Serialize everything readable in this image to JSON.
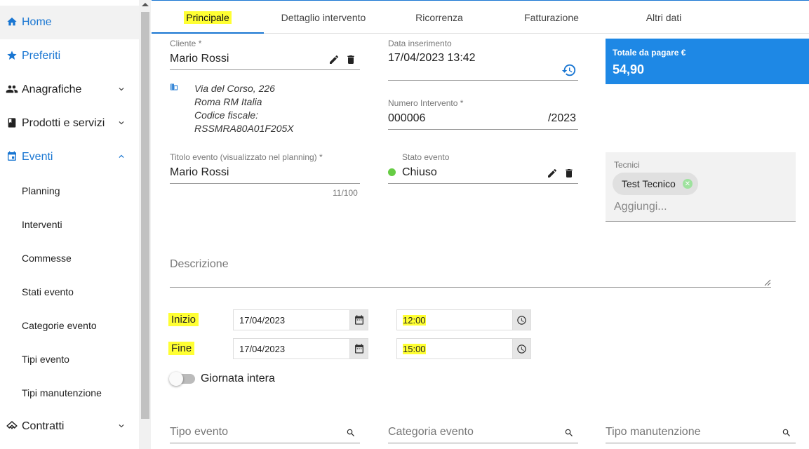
{
  "sidebar": {
    "items": [
      {
        "label": "Home",
        "icon": "home-icon"
      },
      {
        "label": "Preferiti",
        "icon": "star-icon"
      },
      {
        "label": "Anagrafiche",
        "icon": "people-icon"
      },
      {
        "label": "Prodotti e servizi",
        "icon": "book-icon"
      },
      {
        "label": "Eventi",
        "icon": "calendar-icon"
      },
      {
        "label": "Contratti",
        "icon": "handshake-icon"
      }
    ],
    "sub_items": [
      "Planning",
      "Interventi",
      "Commesse",
      "Stati evento",
      "Categorie evento",
      "Tipi evento",
      "Tipi manutenzione"
    ]
  },
  "tabs": [
    "Principale",
    "Dettaglio intervento",
    "Ricorrenza",
    "Fatturazione",
    "Altri dati"
  ],
  "form": {
    "cliente_label": "Cliente *",
    "cliente_value": "Mario Rossi",
    "address_line1": "Via del Corso, 226",
    "address_line2": "Roma RM Italia",
    "address_line3": "Codice fiscale:",
    "address_line4": "RSSMRA80A01F205X",
    "data_ins_label": "Data inserimento",
    "data_ins_value": "17/04/2023 13:42",
    "numero_label": "Numero Intervento *",
    "numero_value": "000006",
    "numero_suffix": "/2023",
    "titolo_label": "Titolo evento (visualizzato nel planning) *",
    "titolo_value": "Mario Rossi",
    "titolo_counter": "11/100",
    "stato_label": "Stato evento",
    "stato_value": "Chiuso",
    "descrizione_placeholder": "Descrizione",
    "inizio_label": "Inizio",
    "fine_label": "Fine",
    "inizio_date": "17/04/2023",
    "inizio_time": "12:00",
    "fine_date": "17/04/2023",
    "fine_time": "15:00",
    "giornata_label": "Giornata intera",
    "tipo_evento_placeholder": "Tipo evento",
    "categoria_evento_placeholder": "Categoria evento",
    "tipo_manutenzione_placeholder": "Tipo manutenzione"
  },
  "total": {
    "label": "Totale da pagare €",
    "value": "54,90"
  },
  "tecnici": {
    "label": "Tecnici",
    "chip": "Test Tecnico",
    "placeholder": "Aggiungi..."
  },
  "colors": {
    "accent": "#1976d2",
    "total_bg": "#1e88e5",
    "status_green": "#66cc44",
    "highlight": "#ffff33"
  }
}
